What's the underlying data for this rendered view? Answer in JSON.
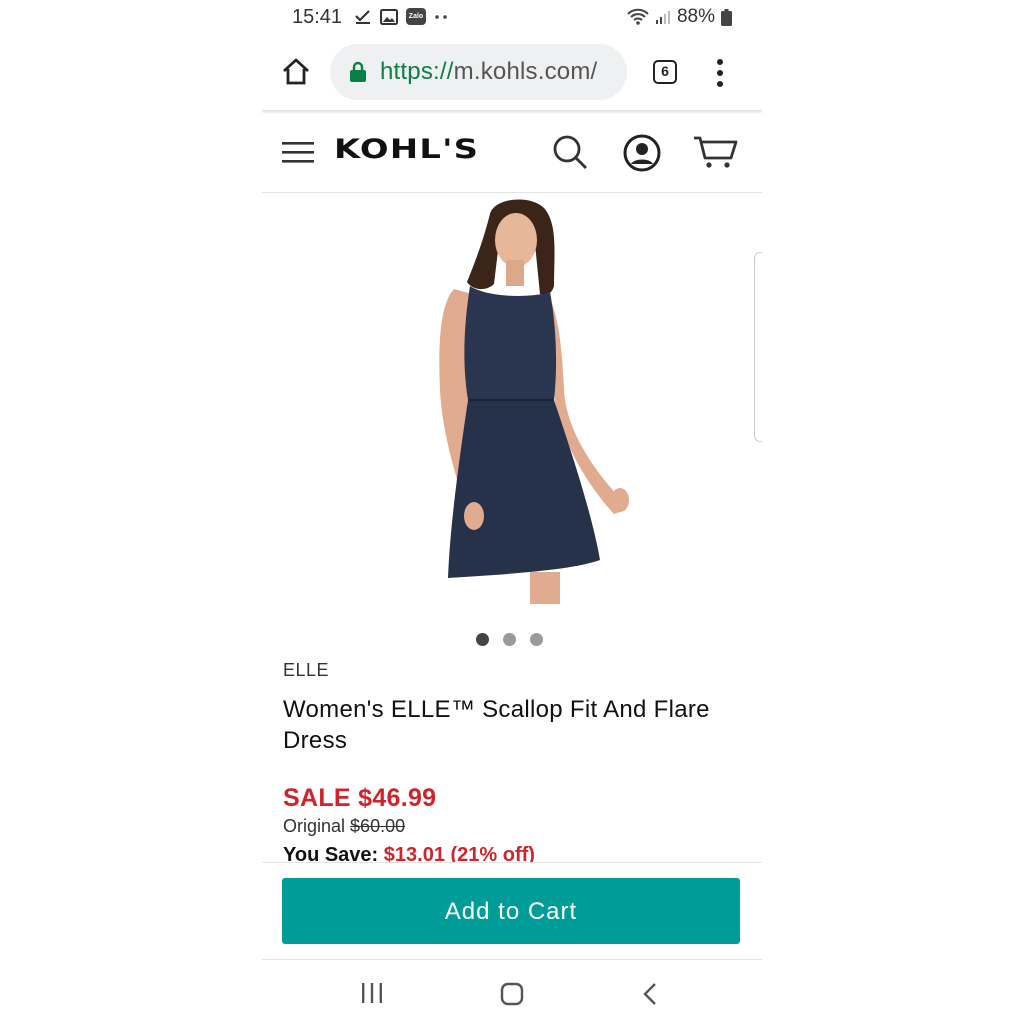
{
  "status_bar": {
    "time": "15:41",
    "battery": "88%",
    "app_icons": [
      "check-download-icon",
      "image-icon",
      "zalo-icon",
      "more-dots-icon"
    ],
    "zalo_label": "Zalo"
  },
  "browser": {
    "url_scheme": "https://",
    "url_host": "m.kohls.com/",
    "tab_count": "6"
  },
  "site": {
    "logo": "KOHL'S"
  },
  "product": {
    "brand": "ELLE",
    "title": "Women's ELLE™ Scallop Fit And Flare Dress",
    "sale_price": "SALE $46.99",
    "original_label": "Original",
    "original_price": "$60.00",
    "you_save_label": "You Save:",
    "you_save_amount": "$13.01 (21% off)",
    "image_count": 3,
    "active_image": 1
  },
  "actions": {
    "add_to_cart": "Add to Cart"
  },
  "colors": {
    "sale_red": "#d0232b",
    "cart_teal": "#009d98",
    "secure_green": "#0b8043",
    "dress_navy": "#2a3550"
  }
}
